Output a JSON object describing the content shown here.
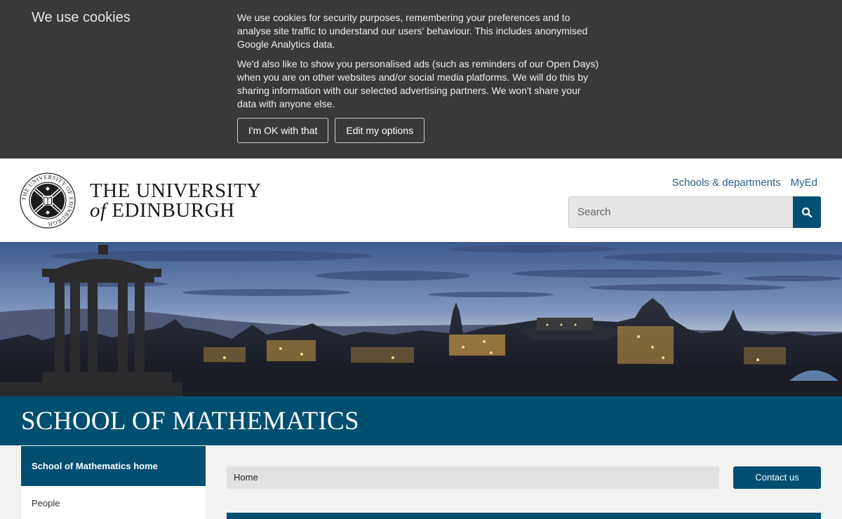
{
  "cookie_banner": {
    "title": "We use cookies",
    "paragraph_1": "We use cookies for security purposes, remembering your preferences and to analyse site traffic to understand our users' behaviour. This includes anonymised Google Analytics data.",
    "paragraph_2": "We'd also like to show you personalised ads (such as reminders of our Open Days) when you are on other websites and/or social media platforms. We will do this by sharing information with our selected advertising partners. We won't share your data with anyone else.",
    "accept_label": "I'm OK with that",
    "options_label": "Edit my options"
  },
  "header": {
    "wordmark_line1": "THE UNIVERSITY",
    "wordmark_of": "of",
    "wordmark_line2": "EDINBURGH",
    "crest_text": "THE UNIVERSITY OF EDINBURGH",
    "links": [
      "Schools & departments",
      "MyEd"
    ],
    "search_placeholder": "Search",
    "search_icon": "search-icon"
  },
  "school": {
    "title": "SCHOOL OF MATHEMATICS"
  },
  "sidebar": {
    "items": [
      {
        "label": "School of Mathematics home",
        "active": true
      },
      {
        "label": "People",
        "active": false
      }
    ]
  },
  "breadcrumb": {
    "items": [
      "Home"
    ]
  },
  "contact_label": "Contact us",
  "colors": {
    "brand": "#004f71",
    "cookie_bg": "#393939",
    "link": "#2c5e8f"
  }
}
